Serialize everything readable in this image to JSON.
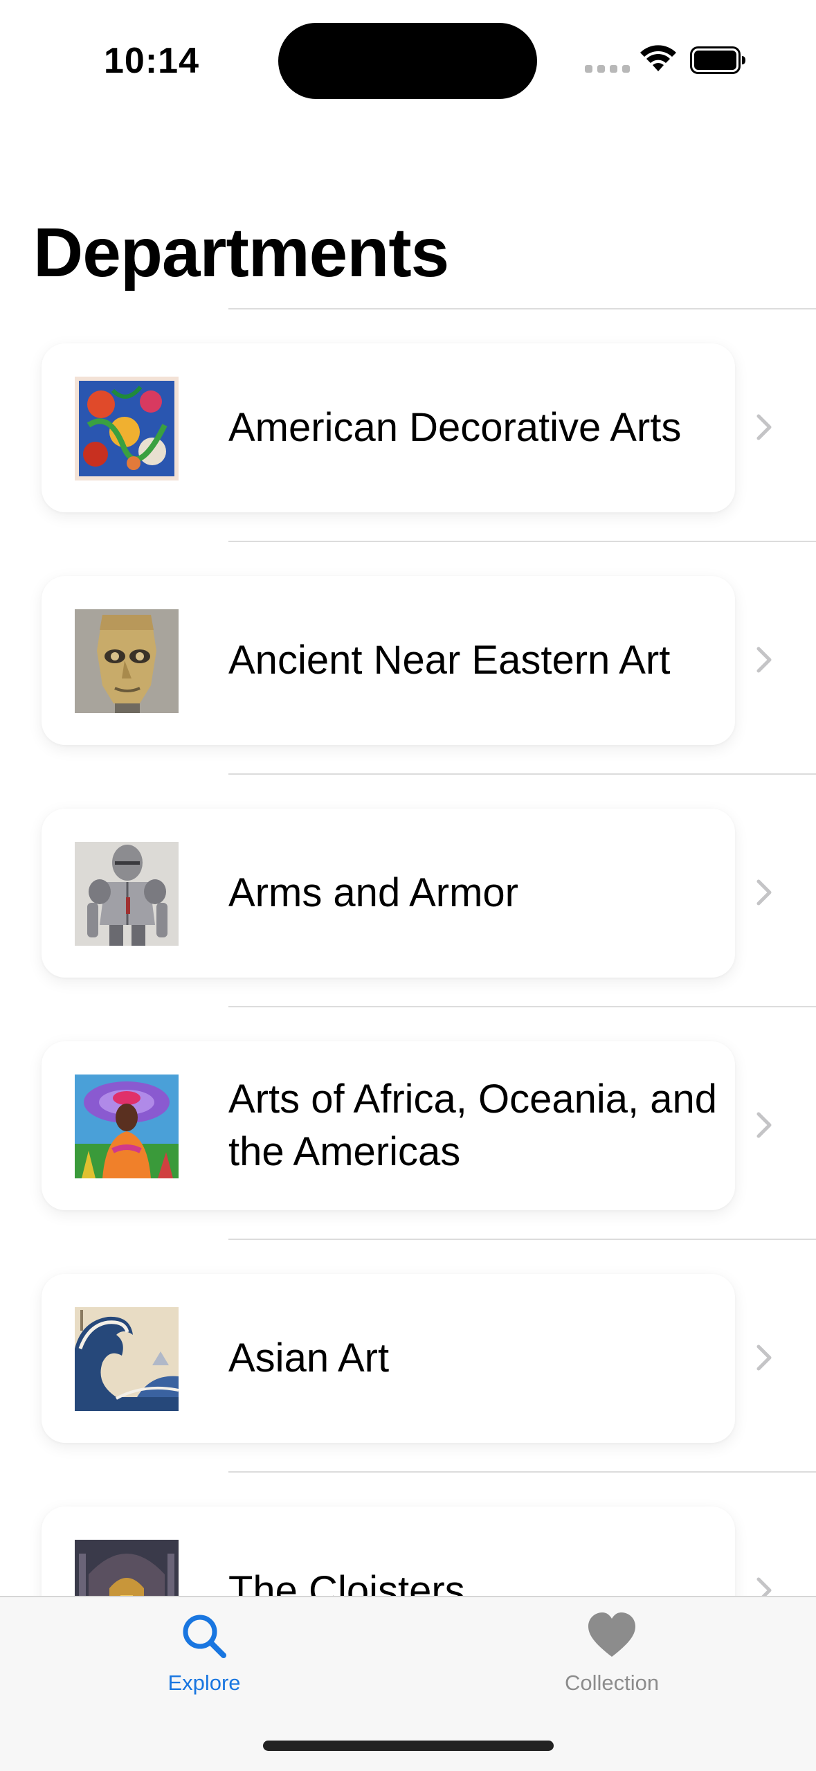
{
  "status_bar": {
    "time": "10:14"
  },
  "page": {
    "title": "Departments"
  },
  "departments": [
    {
      "label": "American Decorative Arts",
      "thumb": "floral-tapestry-image"
    },
    {
      "label": "Ancient Near Eastern Art",
      "thumb": "metal-mask-image"
    },
    {
      "label": "Arms and Armor",
      "thumb": "suit-of-armor-image"
    },
    {
      "label": "Arts of Africa, Oceania, and the Americas",
      "thumb": "colorful-portrait-image"
    },
    {
      "label": "Asian Art",
      "thumb": "great-wave-image"
    },
    {
      "label": "The Cloisters",
      "thumb": "cloister-interior-image"
    }
  ],
  "tabs": [
    {
      "label": "Explore",
      "icon": "magnifier-icon",
      "active": true
    },
    {
      "label": "Collection",
      "icon": "heart-icon",
      "active": false
    }
  ],
  "colors": {
    "accent": "#1976e0",
    "inactive": "#8c8c8c",
    "tab_bar_bg": "#f7f7f7"
  }
}
